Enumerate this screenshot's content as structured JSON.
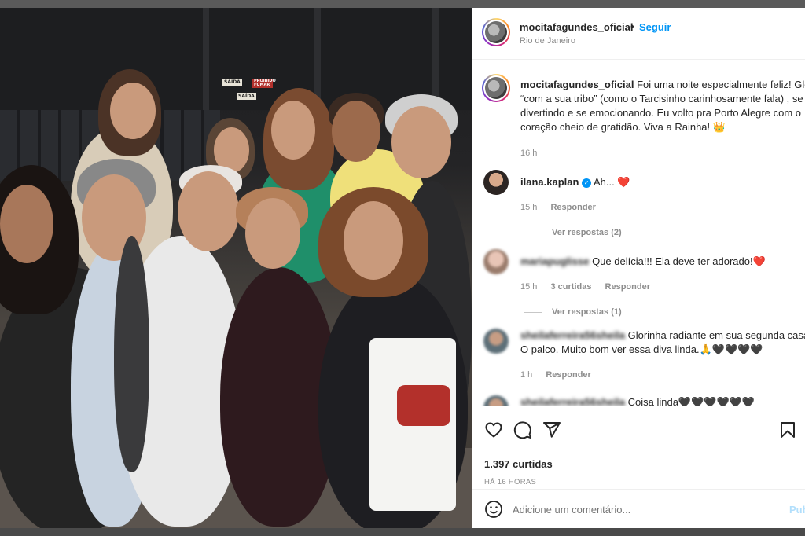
{
  "post": {
    "username": "mocitafagundes_oficial",
    "follow_label": "Seguir",
    "separator": "•",
    "location": "Rio de Janeiro",
    "caption_user": "mocitafagundes_oficial",
    "caption_line1": "Foi uma noite especialmente feliz! Glóri",
    "caption_line2": "“com a sua tribo” (como o Tarcisinho carinhosamente fala) , se",
    "caption_line3": "divertindo e se emocionando. Eu volto pra Porto Alegre com o",
    "caption_line4": "coração cheio de gratidão. Viva a Rainha! 👑",
    "caption_time": "16 h"
  },
  "photo": {
    "signs": [
      "SAÍDA",
      "PROIBIDO FUMAR",
      "SAÍDA"
    ]
  },
  "comments": [
    {
      "user": "ilana.kaplan",
      "verified": true,
      "text": "Ah... ❤️",
      "time": "15 h",
      "reply": "Responder",
      "replies": "Ver respostas (2)"
    },
    {
      "user": "mariapuglisse",
      "text": "Que delícia!!! Ela deve ter adorado!❤️",
      "time": "15 h",
      "likes": "3 curtidas",
      "reply": "Responder",
      "replies": "Ver respostas (1)"
    },
    {
      "user": "sheilaferreira56sheila",
      "text_line1": "Glorinha radiante em sua segunda casa.",
      "text_line2": "O palco. Muito bom ver essa diva linda.🙏🖤🖤🖤🖤",
      "time": "1 h",
      "reply": "Responder"
    },
    {
      "user": "sheilaferreira56sheila",
      "text": "Coisa linda🖤🖤🖤🖤🖤🖤"
    }
  ],
  "actions": {
    "icons": [
      "heart-icon",
      "comment-icon",
      "share-icon",
      "bookmark-icon"
    ],
    "likes": "1.397 curtidas",
    "date": "HÁ 16 HORAS"
  },
  "add_comment": {
    "placeholder": "Adicione um comentário...",
    "publish": "Publicar"
  }
}
